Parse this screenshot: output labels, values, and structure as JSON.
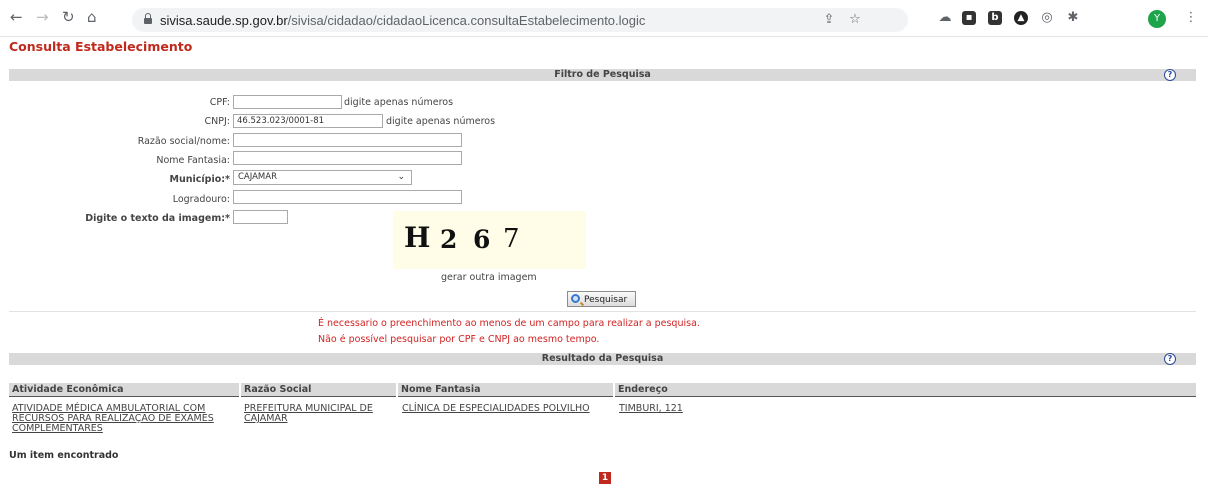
{
  "browser": {
    "url_host": "sivisa.saude.sp.gov.br",
    "url_path": "/sivisa/cidadao/cidadaoLicenca.consultaEstabelecimento.logic",
    "profile_initial": "Y",
    "extension_b": "b"
  },
  "page": {
    "title": "Consulta Estabelecimento"
  },
  "filter": {
    "header": "Filtro de Pesquisa",
    "help": "?",
    "cpf": {
      "label": "CPF:",
      "value": "",
      "hint": "digite apenas números"
    },
    "cnpj": {
      "label": "CNPJ:",
      "value": "46.523.023/0001-81",
      "hint": "digite apenas números"
    },
    "razao": {
      "label": "Razão social/nome:",
      "value": ""
    },
    "fantasia": {
      "label": "Nome Fantasia:",
      "value": ""
    },
    "municipio": {
      "label": "Município:*",
      "value": "CAJAMAR"
    },
    "logradouro": {
      "label": "Logradouro:",
      "value": ""
    },
    "captcha_text": {
      "label": "Digite o texto da imagem:*",
      "value": ""
    },
    "captcha_chars": [
      "H",
      "2",
      "6",
      "7"
    ],
    "captcha_regen": "gerar outra imagem",
    "search_button": "Pesquisar"
  },
  "messages": {
    "line1": "É necessario o preenchimento ao menos de um campo para realizar a pesquisa.",
    "line2": "Não é possível pesquisar por CPF e CNPJ ao mesmo tempo."
  },
  "results": {
    "header": "Resultado da Pesquisa",
    "help": "?",
    "columns": [
      "Atividade Econômica",
      "Razão Social",
      "Nome Fantasia",
      "Endereço"
    ],
    "row": {
      "atividade": [
        "ATIVIDADE MÉDICA AMBULATORIAL COM",
        "RECURSOS PARA REALIZAÇÃO DE EXAMES",
        "COMPLEMENTARES"
      ],
      "razao": [
        "PREFEITURA MUNICIPAL DE",
        "CAJAMAR"
      ],
      "fantasia": "CLÍNICA DE ESPECIALIDADES POLVILHO",
      "endereco": "TIMBURI, 121"
    },
    "count_text": "Um item encontrado",
    "page": "1"
  },
  "colors": {
    "title_red": "#c0291d",
    "error_red": "#d12323",
    "bar_gray": "#d9d9d9"
  }
}
